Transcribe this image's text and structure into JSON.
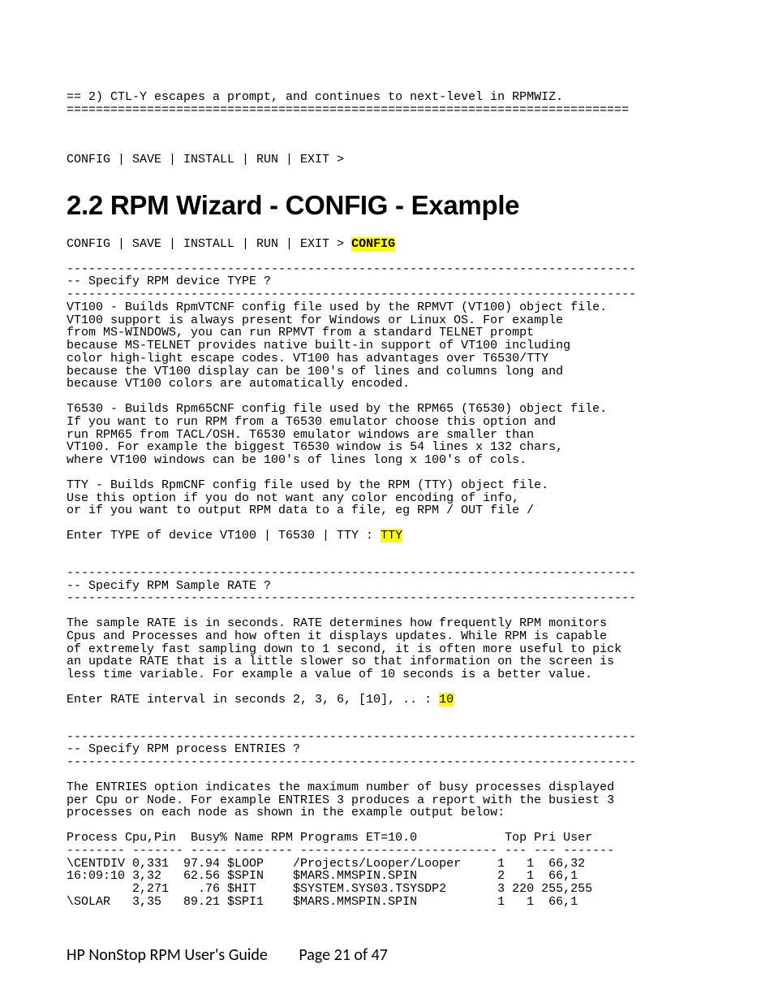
{
  "top": {
    "note": "== 2) CTL-Y escapes a prompt, and continues to next-level in RPMWIZ.",
    "rule": "=============================================================================",
    "prompt": "CONFIG | SAVE | INSTALL | RUN | EXIT >"
  },
  "heading": "2.2 RPM Wizard - CONFIG - Example",
  "config_prompt": {
    "prefix": "CONFIG | SAVE | INSTALL | RUN | EXIT > ",
    "input": "CONFIG"
  },
  "dashes": "------------------------------------------------------------------------------",
  "type_section": {
    "title": "-- Specify RPM device TYPE ?",
    "vt100_desc": "VT100 - Builds RpmVTCNF config file used by the RPMVT (VT100) object file.\nVT100 support is always present for Windows or Linux OS. For example\nfrom MS-WINDOWS, you can run RPMVT from a standard TELNET prompt\nbecause MS-TELNET provides native built-in support of VT100 including\ncolor high-light escape codes. VT100 has advantages over T6530/TTY\nbecause the VT100 display can be 100's of lines and columns long and\nbecause VT100 colors are automatically encoded.",
    "t6530_desc": "T6530 - Builds Rpm65CNF config file used by the RPM65 (T6530) object file.\nIf you want to run RPM from a T6530 emulator choose this option and\nrun RPM65 from TACL/OSH. T6530 emulator windows are smaller than\nVT100. For example the biggest T6530 window is 54 lines x 132 chars,\nwhere VT100 windows can be 100's of lines long x 100's of cols.",
    "tty_desc": "TTY - Builds RpmCNF config file used by the RPM (TTY) object file.\nUse this option if you do not want any color encoding of info,\nor if you want to output RPM data to a file, eg RPM / OUT file /",
    "prompt_prefix": "Enter TYPE of device VT100 | T6530 | TTY : ",
    "prompt_value": "TTY"
  },
  "rate_section": {
    "title": "-- Specify RPM Sample RATE ?",
    "desc": "The sample RATE is in seconds. RATE determines how frequently RPM monitors\nCpus and Processes and how often it displays updates. While RPM is capable\nof extremely fast sampling down to 1 second, it is often more useful to pick\nan update RATE that is a little slower so that information on the screen is\nless time variable. For example a value of 10 seconds is a better value.",
    "prompt_prefix": "Enter RATE interval in seconds 2, 3, 6, [10], .. : ",
    "prompt_value": "10"
  },
  "entries_section": {
    "title": "-- Specify RPM process ENTRIES ?",
    "desc": "The ENTRIES option indicates the maximum number of busy processes displayed\nper Cpu or Node. For example ENTRIES 3 produces a report with the busiest 3\nprocesses on each node as shown in the example output below:",
    "table": "Process Cpu,Pin  Busy% Name RPM Programs ET=10.0            Top Pri User\n-------- ------- ----- -------- --------------------------- --- --- -------\n\\CENTDIV 0,331  97.94 $LOOP    /Projects/Looper/Looper     1   1  66,32\n16:09:10 3,32   62.56 $SPIN    $MARS.MMSPIN.SPIN           2   1  66,1\n         2,271    .76 $HIT     $SYSTEM.SYS03.TSYSDP2       3 220 255,255\n\\SOLAR   3,35   89.21 $SPI1    $MARS.MMSPIN.SPIN           1   1  66,1"
  },
  "footer": {
    "title": "HP NonStop RPM User's Guide",
    "page": "Page 21 of 47"
  }
}
